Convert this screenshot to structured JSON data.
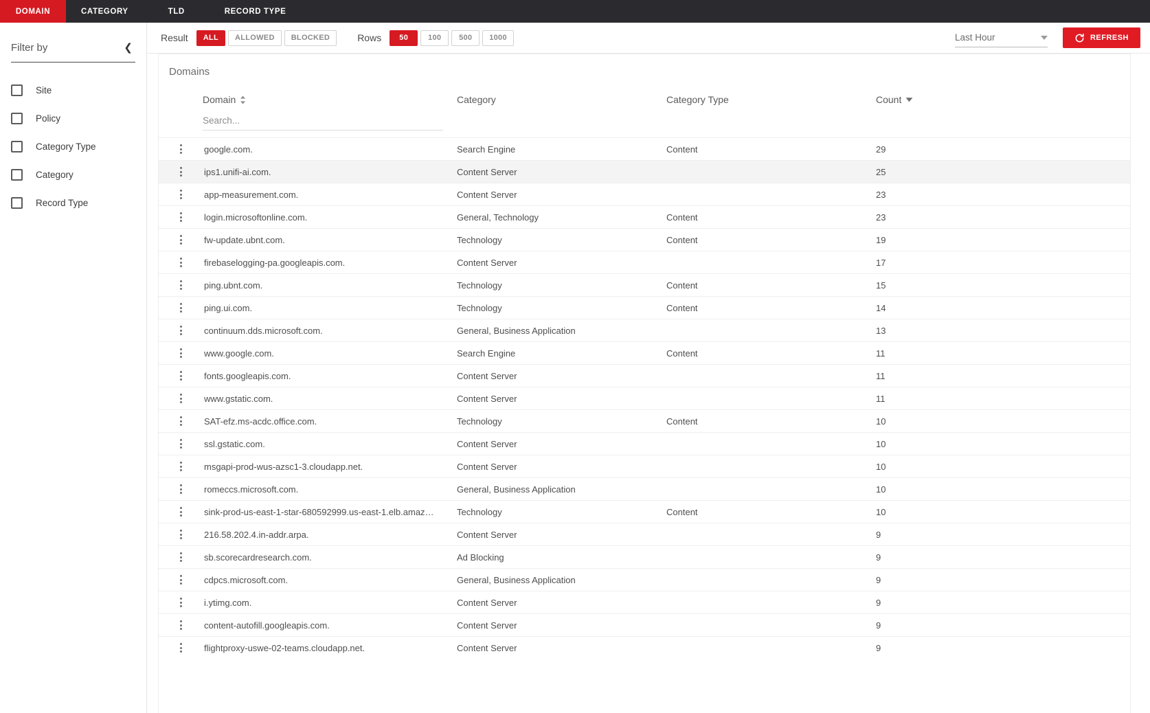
{
  "nav": {
    "tabs": [
      {
        "label": "DOMAIN",
        "active": true
      },
      {
        "label": "CATEGORY",
        "active": false
      },
      {
        "label": "TLD",
        "active": false
      },
      {
        "label": "RECORD TYPE",
        "active": false
      }
    ]
  },
  "sidebar": {
    "title": "Filter by",
    "collapse_icon": "chevron-left-icon",
    "items": [
      {
        "label": "Site",
        "checked": false
      },
      {
        "label": "Policy",
        "checked": false
      },
      {
        "label": "Category Type",
        "checked": false
      },
      {
        "label": "Category",
        "checked": false
      },
      {
        "label": "Record Type",
        "checked": false
      }
    ]
  },
  "toolbar": {
    "result_label": "Result",
    "result_options": [
      {
        "label": "ALL",
        "active": true
      },
      {
        "label": "ALLOWED",
        "active": false
      },
      {
        "label": "BLOCKED",
        "active": false
      }
    ],
    "rows_label": "Rows",
    "rows_options": [
      {
        "label": "50",
        "active": true
      },
      {
        "label": "100",
        "active": false
      },
      {
        "label": "500",
        "active": false
      },
      {
        "label": "1000",
        "active": false
      }
    ],
    "time_range": "Last Hour",
    "refresh_label": "REFRESH"
  },
  "card": {
    "title": "Domains",
    "search_placeholder": "Search...",
    "search_value": "",
    "columns": [
      {
        "key": "domain",
        "label": "Domain",
        "sort": "both"
      },
      {
        "key": "category",
        "label": "Category",
        "sort": "none"
      },
      {
        "key": "category_type",
        "label": "Category Type",
        "sort": "none"
      },
      {
        "key": "count",
        "label": "Count",
        "sort": "desc"
      }
    ],
    "rows": [
      {
        "domain": "google.com.",
        "category": "Search Engine",
        "category_type": "Content",
        "count": "29",
        "highlight": false
      },
      {
        "domain": "ips1.unifi-ai.com.",
        "category": "Content Server",
        "category_type": "",
        "count": "25",
        "highlight": true
      },
      {
        "domain": "app-measurement.com.",
        "category": "Content Server",
        "category_type": "",
        "count": "23",
        "highlight": false
      },
      {
        "domain": "login.microsoftonline.com.",
        "category": "General, Technology",
        "category_type": "Content",
        "count": "23",
        "highlight": false
      },
      {
        "domain": "fw-update.ubnt.com.",
        "category": "Technology",
        "category_type": "Content",
        "count": "19",
        "highlight": false
      },
      {
        "domain": "firebaselogging-pa.googleapis.com.",
        "category": "Content Server",
        "category_type": "",
        "count": "17",
        "highlight": false
      },
      {
        "domain": "ping.ubnt.com.",
        "category": "Technology",
        "category_type": "Content",
        "count": "15",
        "highlight": false
      },
      {
        "domain": "ping.ui.com.",
        "category": "Technology",
        "category_type": "Content",
        "count": "14",
        "highlight": false
      },
      {
        "domain": "continuum.dds.microsoft.com.",
        "category": "General, Business Application",
        "category_type": "",
        "count": "13",
        "highlight": false
      },
      {
        "domain": "www.google.com.",
        "category": "Search Engine",
        "category_type": "Content",
        "count": "11",
        "highlight": false
      },
      {
        "domain": "fonts.googleapis.com.",
        "category": "Content Server",
        "category_type": "",
        "count": "11",
        "highlight": false
      },
      {
        "domain": "www.gstatic.com.",
        "category": "Content Server",
        "category_type": "",
        "count": "11",
        "highlight": false
      },
      {
        "domain": "SAT-efz.ms-acdc.office.com.",
        "category": "Technology",
        "category_type": "Content",
        "count": "10",
        "highlight": false
      },
      {
        "domain": "ssl.gstatic.com.",
        "category": "Content Server",
        "category_type": "",
        "count": "10",
        "highlight": false
      },
      {
        "domain": "msgapi-prod-wus-azsc1-3.cloudapp.net.",
        "category": "Content Server",
        "category_type": "",
        "count": "10",
        "highlight": false
      },
      {
        "domain": "romeccs.microsoft.com.",
        "category": "General, Business Application",
        "category_type": "",
        "count": "10",
        "highlight": false
      },
      {
        "domain": "sink-prod-us-east-1-star-680592999.us-east-1.elb.amaz…",
        "category": "Technology",
        "category_type": "Content",
        "count": "10",
        "highlight": false
      },
      {
        "domain": "216.58.202.4.in-addr.arpa.",
        "category": "Content Server",
        "category_type": "",
        "count": "9",
        "highlight": false
      },
      {
        "domain": "sb.scorecardresearch.com.",
        "category": "Ad Blocking",
        "category_type": "",
        "count": "9",
        "highlight": false
      },
      {
        "domain": "cdpcs.microsoft.com.",
        "category": "General, Business Application",
        "category_type": "",
        "count": "9",
        "highlight": false
      },
      {
        "domain": "i.ytimg.com.",
        "category": "Content Server",
        "category_type": "",
        "count": "9",
        "highlight": false
      },
      {
        "domain": "content-autofill.googleapis.com.",
        "category": "Content Server",
        "category_type": "",
        "count": "9",
        "highlight": false
      },
      {
        "domain": "flightproxy-uswe-02-teams.cloudapp.net.",
        "category": "Content Server",
        "category_type": "",
        "count": "9",
        "highlight": false
      }
    ]
  },
  "colors": {
    "accent_red": "#d61a22",
    "refresh_red": "#e01b24",
    "navbar_dark": "#2b2b2f"
  }
}
